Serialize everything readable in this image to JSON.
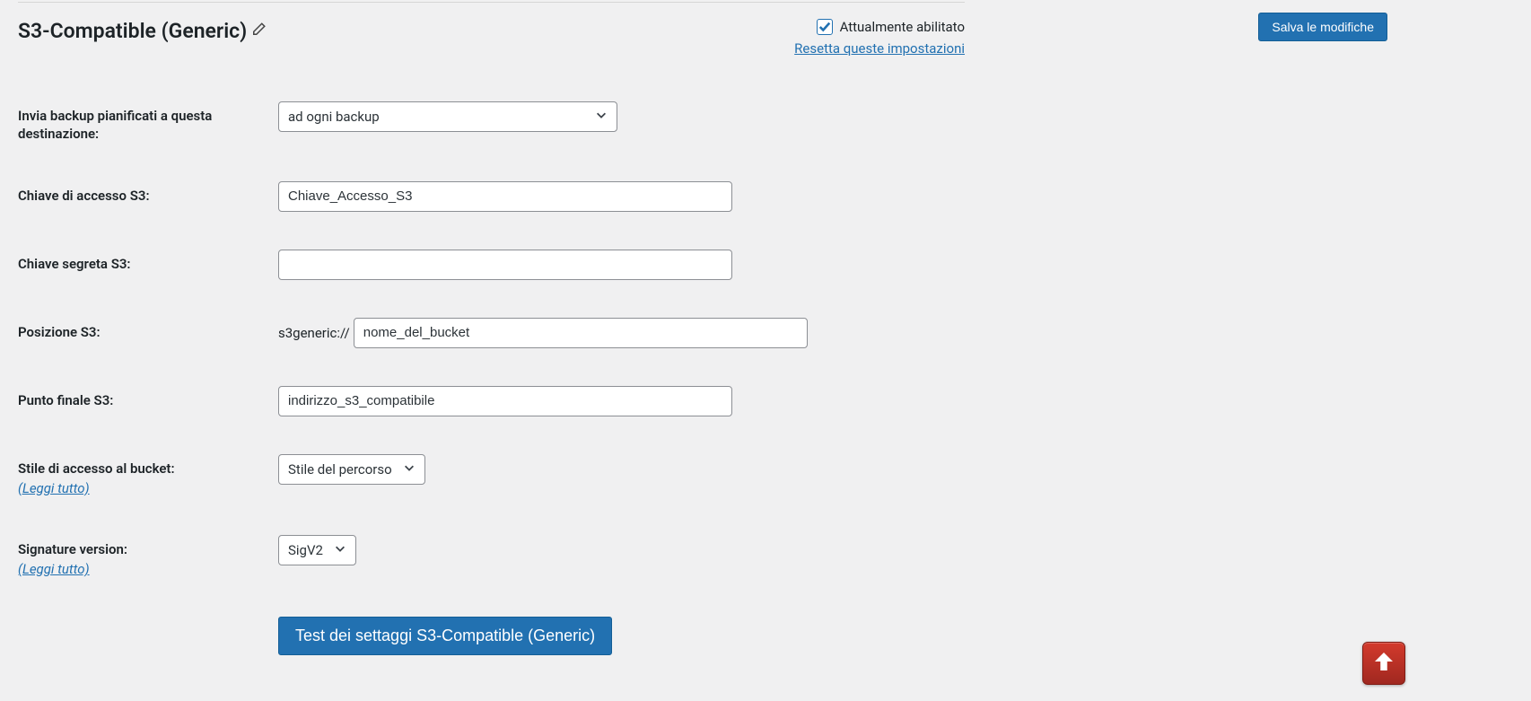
{
  "header": {
    "title": "S3-Compatible (Generic)",
    "enabled_label": "Attualmente abilitato",
    "reset_link": "Resetta queste impostazioni",
    "save_button": "Salva le modifiche"
  },
  "form": {
    "frequency": {
      "label": "Invia backup pianificati a questa destinazione:",
      "value": "ad ogni backup"
    },
    "access_key": {
      "label": "Chiave di accesso S3:",
      "value": "Chiave_Accesso_S3"
    },
    "secret_key": {
      "label": "Chiave segreta S3:",
      "value": ""
    },
    "location": {
      "label": "Posizione S3:",
      "prefix": "s3generic://",
      "value": "nome_del_bucket"
    },
    "endpoint": {
      "label": "Punto finale S3:",
      "value": "indirizzo_s3_compatibile"
    },
    "bucket_style": {
      "label": "Stile di accesso al bucket:",
      "read_more": "(Leggi tutto)",
      "value": "Stile del percorso"
    },
    "sig_version": {
      "label": "Signature version:",
      "read_more": "(Leggi tutto)",
      "value": "SigV2"
    },
    "test_button": "Test dei settaggi S3-Compatible (Generic)"
  }
}
